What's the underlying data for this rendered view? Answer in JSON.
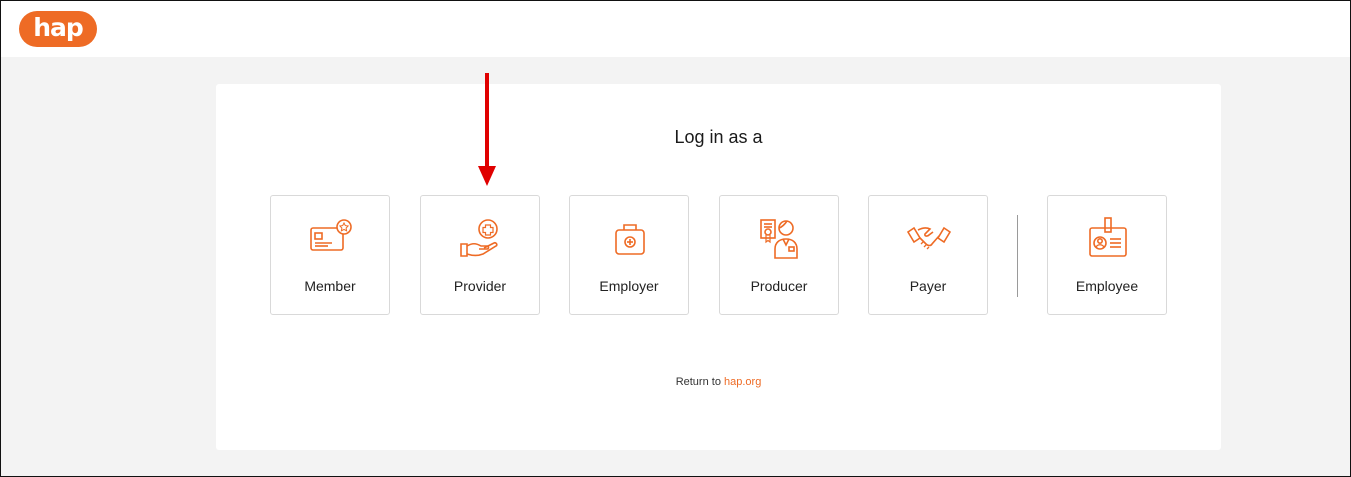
{
  "brand": {
    "logo_text": "hap",
    "accent": "#ee6b25"
  },
  "login": {
    "heading": "Log in as a",
    "roles": [
      {
        "label": "Member",
        "icon": "member-card-icon"
      },
      {
        "label": "Provider",
        "icon": "hand-plus-icon"
      },
      {
        "label": "Employer",
        "icon": "briefcase-icon"
      },
      {
        "label": "Producer",
        "icon": "producer-icon"
      },
      {
        "label": "Payer",
        "icon": "handshake-icon"
      },
      {
        "label": "Employee",
        "icon": "id-badge-icon"
      }
    ],
    "footer_text": "Return to",
    "footer_link": "hap.org"
  },
  "annotation": {
    "arrow_color": "#e00000"
  }
}
